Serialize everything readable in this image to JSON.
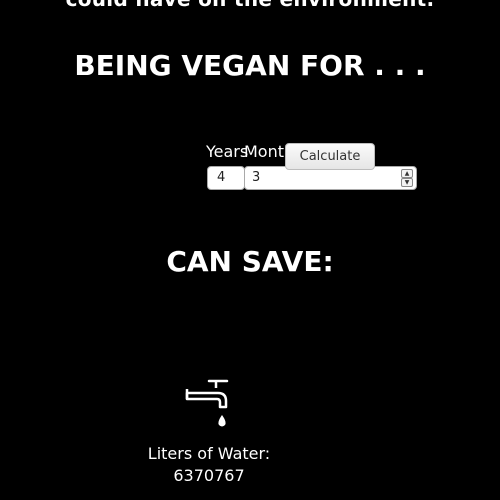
{
  "intro": {
    "text": "could have on the environment."
  },
  "headings": {
    "being_vegan": "BEING VEGAN FOR . . .",
    "can_save": "CAN SAVE:"
  },
  "form": {
    "years_label": "Years",
    "months_label": "Months",
    "years_value": "4",
    "months_value": "3",
    "calculate_label": "Calculate"
  },
  "results": {
    "water": {
      "icon": "water-tap-icon",
      "label": "Liters of Water:",
      "value": "6370767"
    }
  },
  "colors": {
    "background": "#000000",
    "text": "#ffffff"
  }
}
